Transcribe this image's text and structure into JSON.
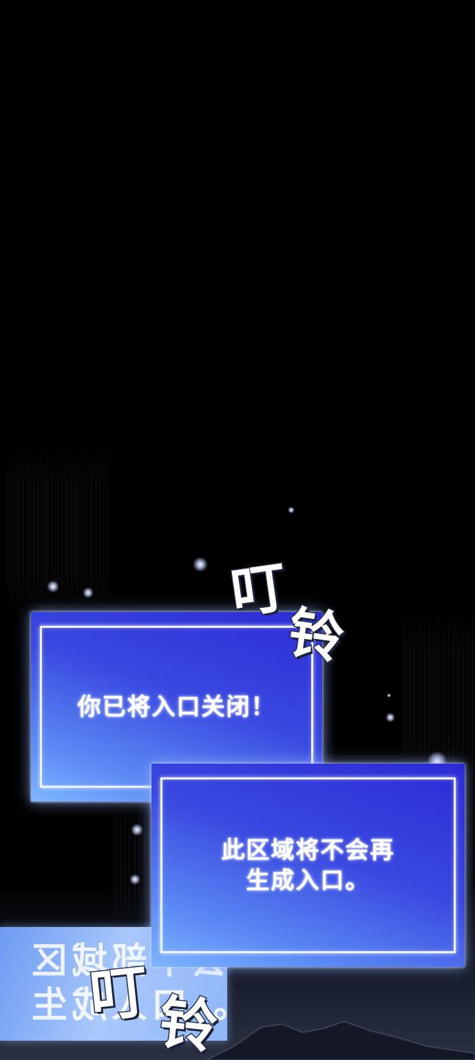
{
  "panel": {
    "messages": [
      {
        "text": "你已将入口关闭！"
      },
      {
        "lines": [
          "此区域将不会再",
          "生成入口。"
        ]
      }
    ],
    "mirrored_text": [
      "会不部域区",
      "。口人成生"
    ],
    "sound_effects": [
      {
        "chars": [
          "叮",
          "铃"
        ]
      },
      {
        "chars": [
          "叮",
          "铃"
        ]
      }
    ]
  },
  "colors": {
    "background": "#000000",
    "window_blue": "#3a49e0",
    "window_light": "#7fb6ff",
    "text": "#ffffff"
  }
}
